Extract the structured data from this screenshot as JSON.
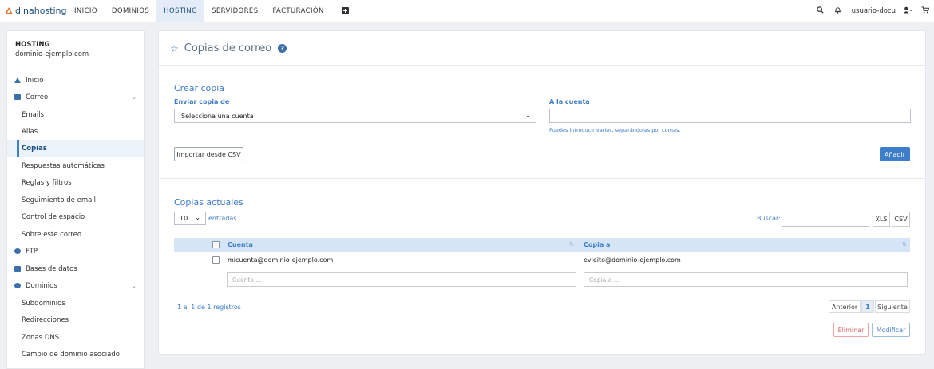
{
  "topbar": {
    "logo": "dinahosting",
    "nav": [
      {
        "label": "INICIO"
      },
      {
        "label": "DOMINIOS"
      },
      {
        "label": "HOSTING"
      },
      {
        "label": "SERVIDORES"
      },
      {
        "label": "FACTURACIÓN"
      }
    ],
    "active_nav": "HOSTING",
    "user": "usuario-docu",
    "icons": [
      "search-icon",
      "bell-icon",
      "user-icon",
      "cart-icon",
      "plus-square-icon"
    ]
  },
  "sidebar": {
    "title": "HOSTING",
    "domain": "dominio-ejemplo.com",
    "items": [
      {
        "label": "Inicio",
        "icon": "home-icon"
      },
      {
        "label": "Correo",
        "icon": "envelope-icon"
      },
      {
        "label": "Emails"
      },
      {
        "label": "Alias"
      },
      {
        "label": "Copias"
      },
      {
        "label": "Respuestas automáticas"
      },
      {
        "label": "Reglas y filtros"
      },
      {
        "label": "Seguimiento de email"
      },
      {
        "label": "Control de espacio"
      },
      {
        "label": "Sobre este correo"
      },
      {
        "label": "FTP",
        "icon": "cloud-upload-icon"
      },
      {
        "label": "Bases de datos",
        "icon": "database-icon"
      },
      {
        "label": "Dominios",
        "icon": "globe-icon"
      },
      {
        "label": "Subdominios"
      },
      {
        "label": "Redirecciones"
      },
      {
        "label": "Zonas DNS"
      },
      {
        "label": "Cambio de dominio asociado"
      }
    ],
    "active_item": "Copias"
  },
  "page": {
    "title": "Copias de correo",
    "create": {
      "title": "Crear copia",
      "send_label": "Enviar copia de",
      "send_value": "Selecciona una cuenta",
      "to_label": "A la cuenta",
      "to_value": "",
      "hint": "Puedes introducir varias, separándolas por comas.",
      "import_button": "Importar desde CSV",
      "add_button": "Añadir"
    },
    "current": {
      "title": "Copias actuales",
      "page_size": "10",
      "entries_label": "entradas",
      "search_label": "Buscar:",
      "search_value": "",
      "export_buttons": [
        "XLS",
        "CSV"
      ],
      "columns": [
        "Cuenta",
        "Copia a"
      ],
      "rows": [
        {
          "cuenta": "micuenta@dominio-ejemplo.com",
          "copia": "evieito@dominio-ejemplo.com"
        }
      ],
      "filter_placeholders": [
        "Cuenta ...",
        "Copia a ..."
      ],
      "info": "1 al 1 de 1 registros",
      "pagination": {
        "prev": "Anterior",
        "current": "1",
        "next": "Siguiente"
      },
      "delete_button": "Eliminar",
      "modify_button": "Modificar"
    }
  }
}
